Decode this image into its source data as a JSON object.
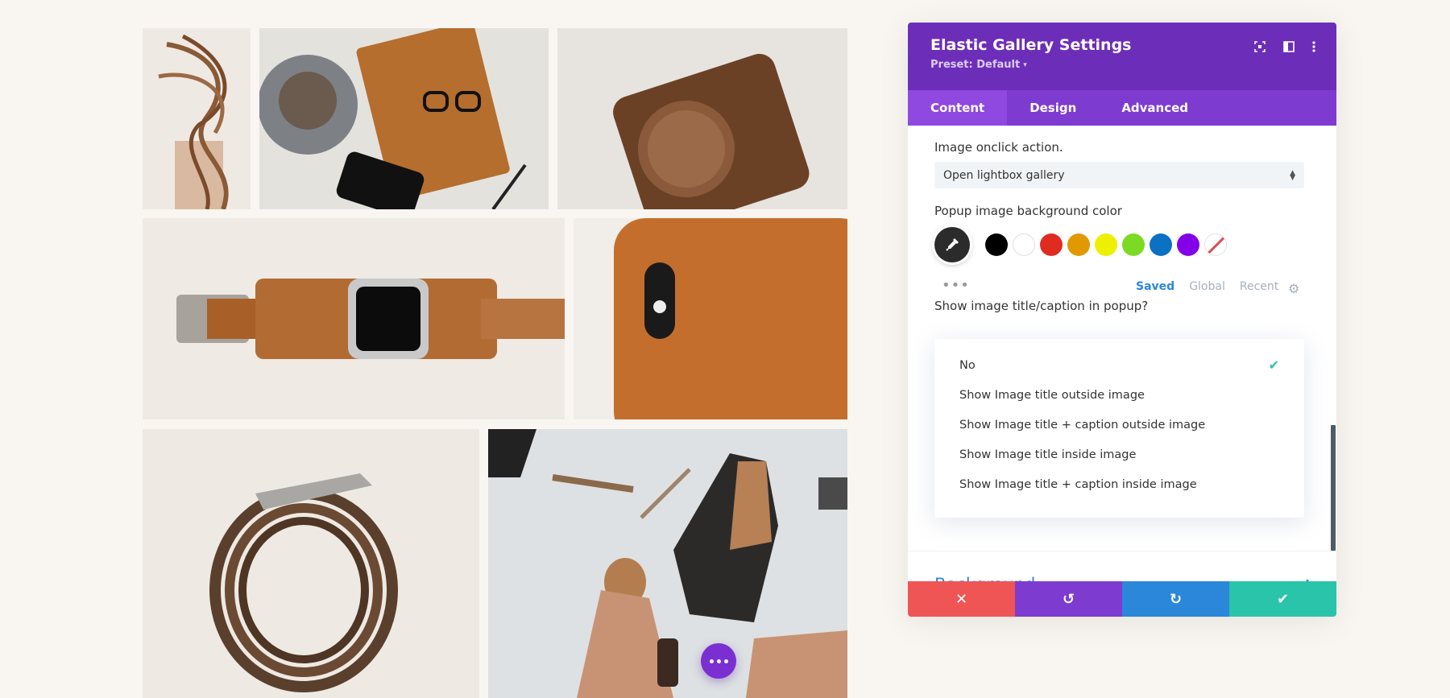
{
  "gallery": {
    "images": [
      {
        "name": "leather-cord-image",
        "colors": [
          "#efe9e4",
          "#8a5a36"
        ]
      },
      {
        "name": "notebook-coffee-image",
        "colors": [
          "#e4e2dd",
          "#b56e2e"
        ]
      },
      {
        "name": "camera-case-image",
        "colors": [
          "#e7e4df",
          "#6b4126"
        ]
      },
      {
        "name": "leather-watch-image",
        "colors": [
          "#efeae4",
          "#b26c33"
        ]
      },
      {
        "name": "phone-case-image",
        "colors": [
          "#c46e2d",
          "#9e5520"
        ]
      },
      {
        "name": "leather-belt-image",
        "colors": [
          "#eee9e3",
          "#5a3f2c"
        ]
      },
      {
        "name": "leather-tools-image",
        "colors": [
          "#dde1e3",
          "#2c2a29"
        ]
      }
    ],
    "fab_icon": "more-dots-icon"
  },
  "panel": {
    "title": "Elastic Gallery Settings",
    "preset": "Preset: Default",
    "header_icons": [
      "focus-icon",
      "split-view-icon",
      "kebab-menu-icon"
    ],
    "tabs": [
      {
        "label": "Content",
        "active": true
      },
      {
        "label": "Design",
        "active": false
      },
      {
        "label": "Advanced",
        "active": false
      }
    ],
    "onclick_label": "Image onclick action.",
    "onclick_value": "Open lightbox gallery",
    "bg_color_label": "Popup image background color",
    "swatches": [
      "#000000",
      "#ffffff",
      "#e02b20",
      "#e09900",
      "#edf000",
      "#7cda24",
      "#0c71c3",
      "#8300e9"
    ],
    "palette_tabs": {
      "saved": "Saved",
      "global": "Global",
      "recent": "Recent"
    },
    "caption_label": "Show image title/caption in popup?",
    "caption_options": [
      {
        "label": "No",
        "selected": true
      },
      {
        "label": "Show Image title outside image",
        "selected": false
      },
      {
        "label": "Show Image title + caption outside image",
        "selected": false
      },
      {
        "label": "Show Image title inside image",
        "selected": false
      },
      {
        "label": "Show Image title + caption inside image",
        "selected": false
      }
    ],
    "section_title": "Background",
    "footer": {
      "cancel_color": "#ef5555",
      "undo_color": "#7e3bd0",
      "redo_color": "#2b87da",
      "save_color": "#29c4a9"
    },
    "colors": {
      "header": "#6c2eb9",
      "tabs": "#7e3bd0",
      "accent": "#2b87da"
    }
  }
}
